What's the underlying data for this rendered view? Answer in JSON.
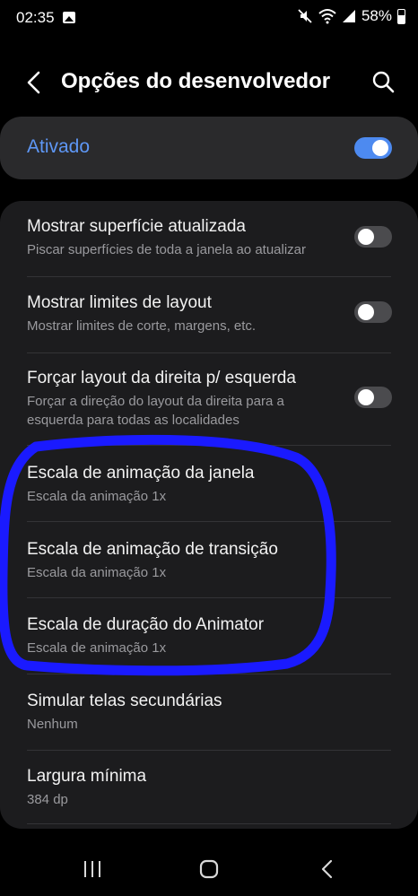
{
  "status_bar": {
    "time": "02:35",
    "battery_percent": "58%",
    "icons": [
      "gallery-icon",
      "mute-icon",
      "wifi-icon",
      "signal-icon",
      "battery-icon"
    ]
  },
  "header": {
    "title": "Opções do desenvolvedor",
    "back_icon": "chevron-left-icon",
    "search_icon": "search-icon"
  },
  "master_switch": {
    "label": "Ativado",
    "enabled": true
  },
  "settings": [
    {
      "title": "Mostrar superfície atualizada",
      "subtitle": "Piscar superfícies de toda a janela ao atualizar",
      "toggle": "off"
    },
    {
      "title": "Mostrar limites de layout",
      "subtitle": "Mostrar limites de corte, margens, etc.",
      "toggle": "off"
    },
    {
      "title": "Forçar layout da direita p/ esquerda",
      "subtitle": "Forçar a direção do layout da direita para a esquerda para todas as localidades",
      "toggle": "off"
    },
    {
      "title": "Escala de animação da janela",
      "subtitle": "Escala da animação 1x"
    },
    {
      "title": "Escala de animação de transição",
      "subtitle": "Escala da animação 1x"
    },
    {
      "title": "Escala de duração do Animator",
      "subtitle": "Escala de animação 1x"
    },
    {
      "title": "Simular telas secundárias",
      "subtitle": "Nenhum"
    },
    {
      "title": "Largura mínima",
      "subtitle": "384 dp"
    }
  ],
  "colors": {
    "accent": "#4d8af0",
    "highlight_marker": "#1a1aff",
    "background": "#000000",
    "card": "#1c1c1e"
  },
  "nav_bar": {
    "icons": [
      "recents-icon",
      "home-icon",
      "back-icon"
    ]
  }
}
